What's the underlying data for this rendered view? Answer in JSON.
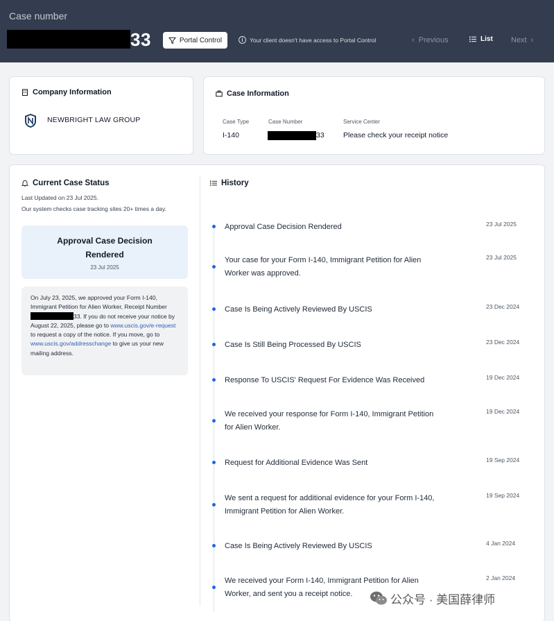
{
  "header": {
    "case_label": "Case number",
    "case_number_suffix": "33",
    "portal_button": "Portal Control",
    "portal_note": "Your client doesn't have access to Portal Control",
    "prev_label": "Previous",
    "list_label": "List",
    "next_label": "Next"
  },
  "company": {
    "title": "Company Information",
    "name": "NEWBRIGHT LAW GROUP"
  },
  "case_info": {
    "title": "Case Information",
    "type_label": "Case Type",
    "type_value": "I-140",
    "number_label": "Case Number",
    "number_suffix": "33",
    "center_label": "Service Center",
    "center_value": "Please check your receipt notice"
  },
  "status": {
    "title": "Current Case Status",
    "last_updated": "Last Updated on 23 Jul 2025.",
    "system_checks": "Our system checks case tracking sites 20+ times a day.",
    "box_title": "Approval Case Decision Rendered",
    "box_date": "23 Jul 2025",
    "desc_part1": "On July 23, 2025, we approved your Form I-140, Immigrant Petition for Alien Worker, Receipt Number",
    "desc_part2": "33. If you do not receive your notice by August 22, 2025, please go to",
    "desc_link1": "www.uscis.gov/e-request",
    "desc_part3": "to request a copy of the notice. If you move, go to",
    "desc_link2": "www.uscis.gov/addresschange",
    "desc_part4": "to give us your new mailing address."
  },
  "history": {
    "title": "History",
    "items": [
      {
        "text": "Approval Case Decision Rendered",
        "date": "23 Jul 2025"
      },
      {
        "text": "Your case for your Form I-140, Immigrant Petition for Alien Worker was approved.",
        "date": "23 Jul 2025"
      },
      {
        "text": "Case Is Being Actively Reviewed By USCIS",
        "date": "23 Dec 2024"
      },
      {
        "text": "Case Is Still Being Processed By USCIS",
        "date": "23 Dec 2024"
      },
      {
        "text": "Response To USCIS' Request For Evidence Was Received",
        "date": "19 Dec 2024"
      },
      {
        "text": "We received your response for Form I-140, Immigrant Petition for Alien Worker.",
        "date": "19 Dec 2024"
      },
      {
        "text": "Request for Additional Evidence Was Sent",
        "date": "19 Sep 2024"
      },
      {
        "text": "We sent a request for additional evidence for your Form I-140, Immigrant Petition for Alien Worker.",
        "date": "19 Sep 2024"
      },
      {
        "text": "Case Is Being Actively Reviewed By USCIS",
        "date": "4 Jan 2024"
      },
      {
        "text": "We received your Form I-140, Immigrant Petition for Alien Worker, and sent you a receipt notice.",
        "date": "2 Jan 2024"
      }
    ]
  },
  "watermark": {
    "text": "公众号 · 美国薛律师"
  },
  "colors": {
    "header_bg": "#343d4f",
    "accent": "#2563eb",
    "status_box_bg": "#e9f1fb"
  }
}
